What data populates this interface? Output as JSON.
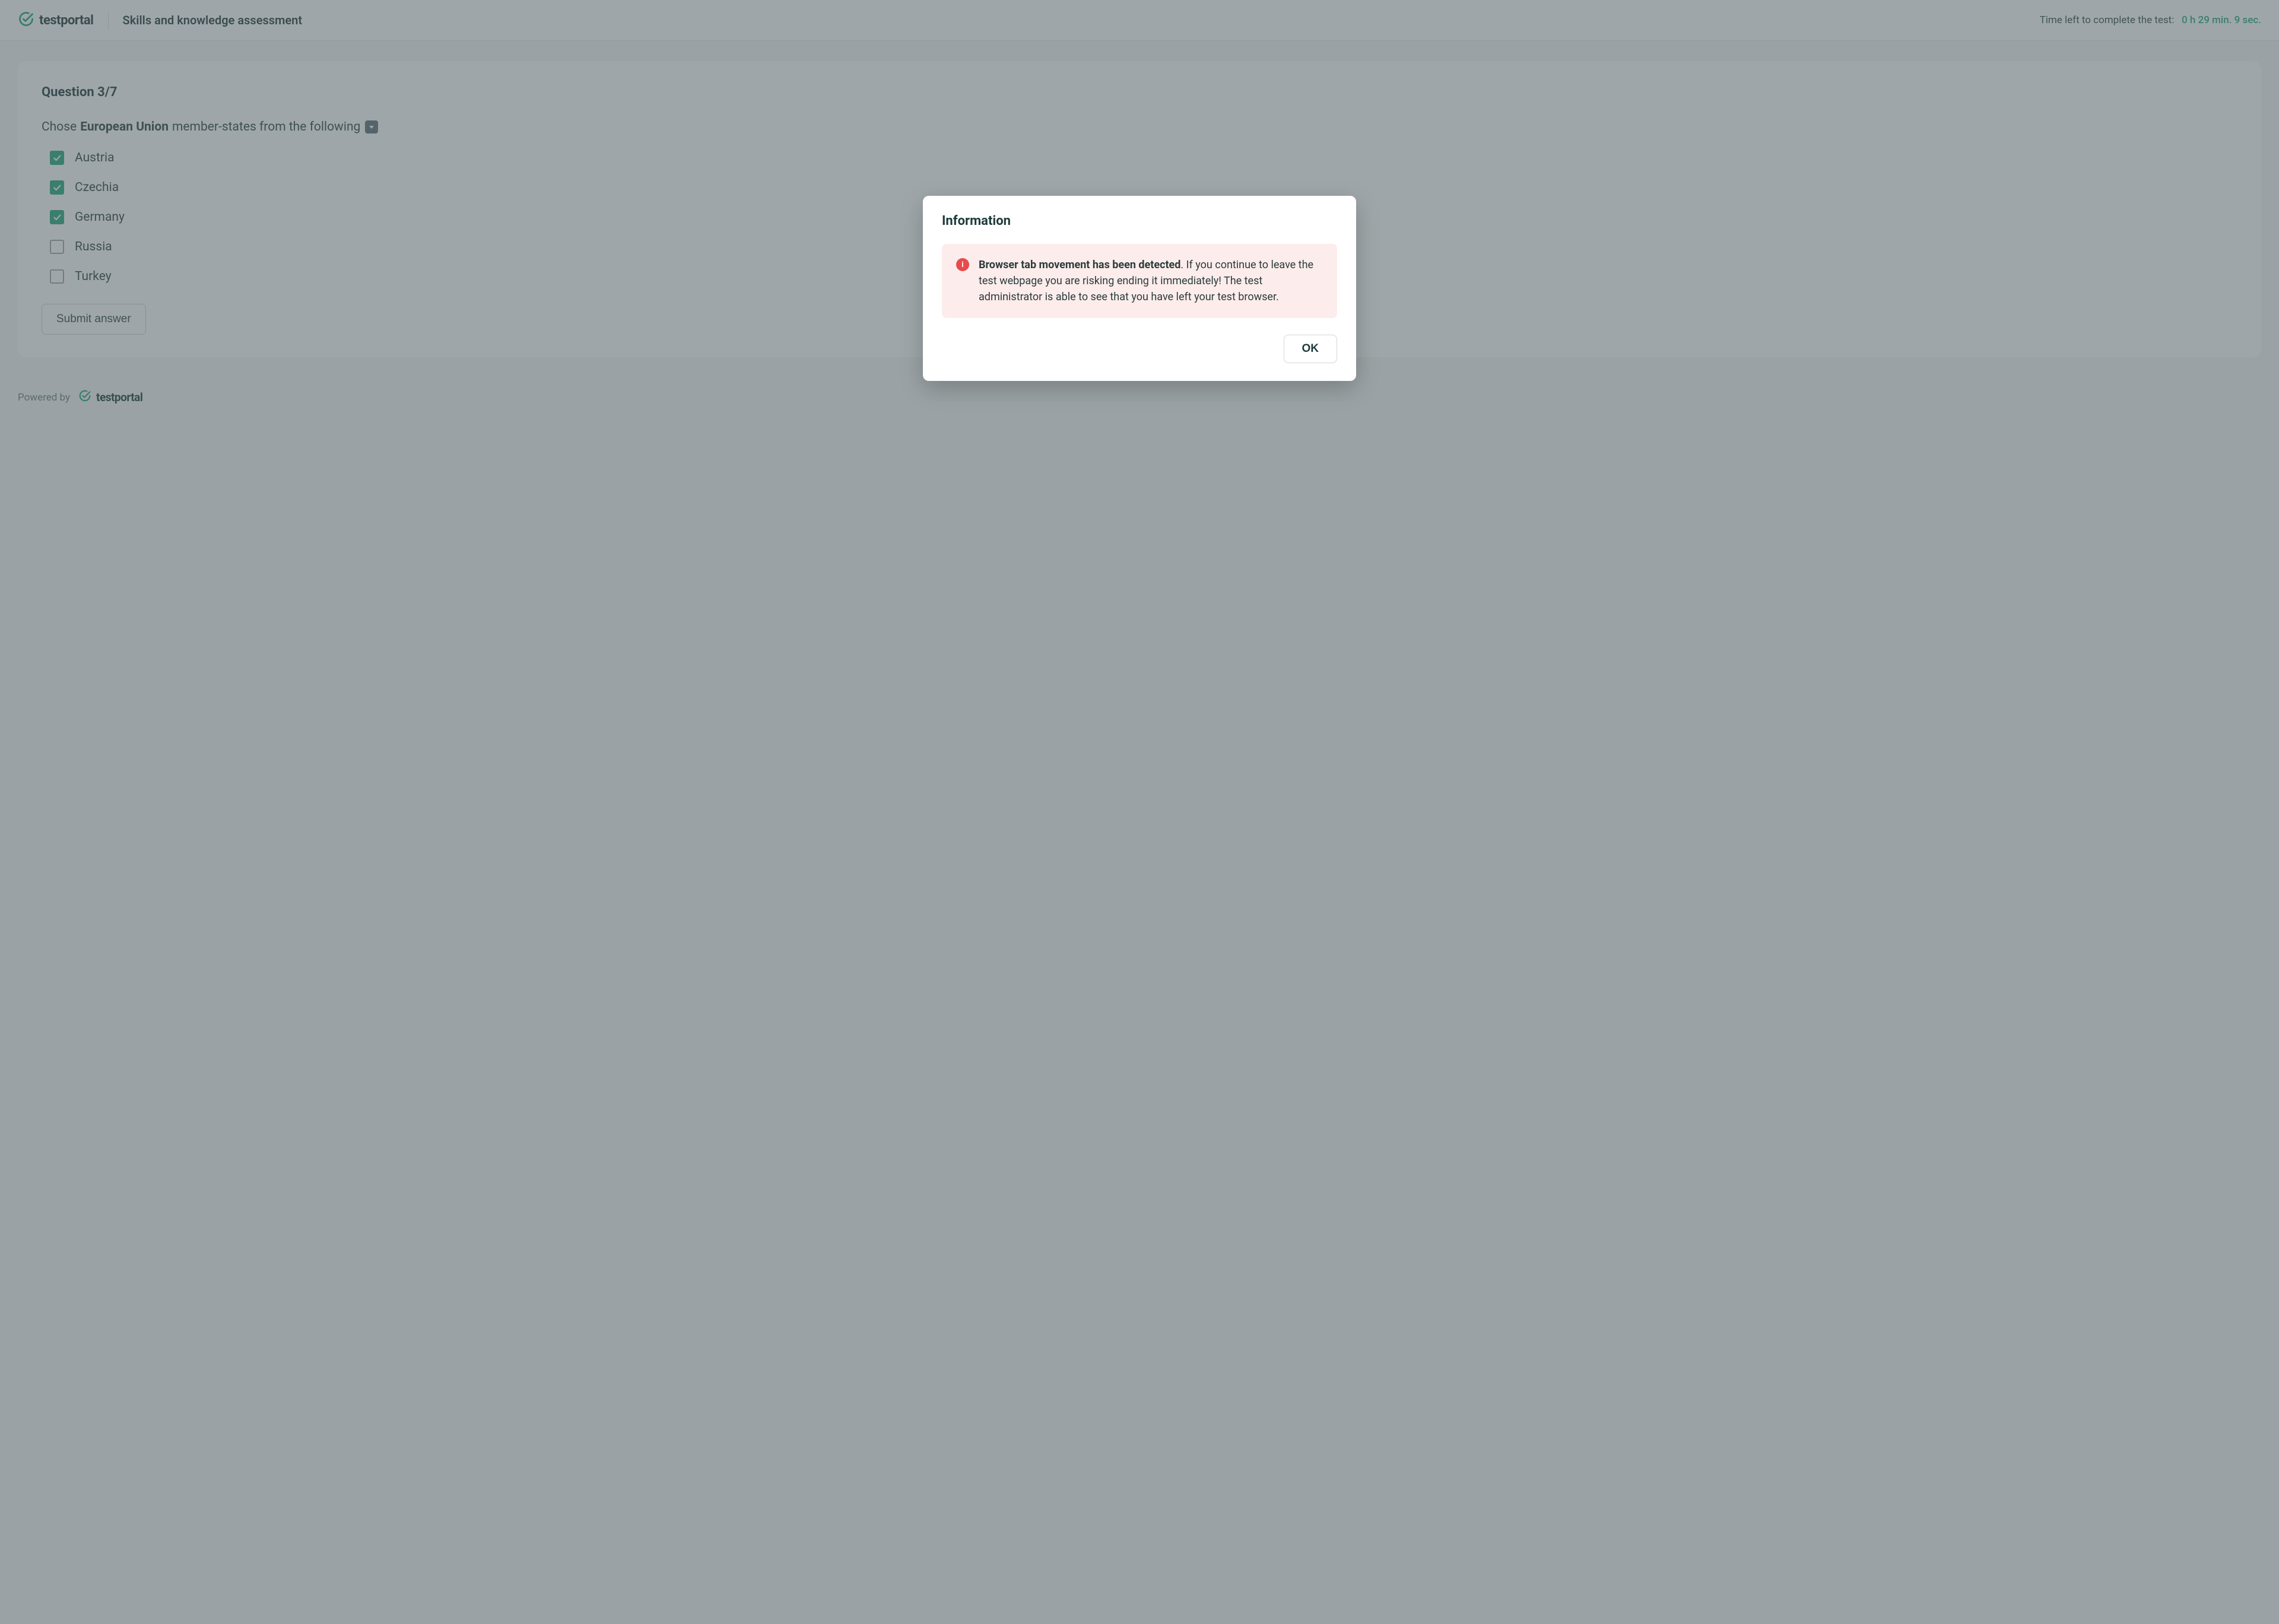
{
  "brand": {
    "name": "testportal",
    "accent": "#1fa97a"
  },
  "header": {
    "title": "Skills and knowledge assessment",
    "timer_label": "Time left to complete the test:",
    "timer_value": "0 h 29 min. 9 sec."
  },
  "question": {
    "number_label": "Question 3/7",
    "text_pre": "Chose",
    "text_strong": "European Union",
    "text_post": "member-states from the following",
    "options": [
      {
        "label": "Austria",
        "checked": true
      },
      {
        "label": "Czechia",
        "checked": true
      },
      {
        "label": "Germany",
        "checked": true
      },
      {
        "label": "Russia",
        "checked": false
      },
      {
        "label": "Turkey",
        "checked": false
      }
    ],
    "submit_label": "Submit answer"
  },
  "footer": {
    "powered_by": "Powered by"
  },
  "modal": {
    "title": "Information",
    "alert_strong": "Browser tab movement has been detected",
    "alert_rest": ". If you continue to leave the test webpage you are risking ending it immediately! The test administrator is able to see that you have left your test browser.",
    "ok_label": "OK"
  }
}
